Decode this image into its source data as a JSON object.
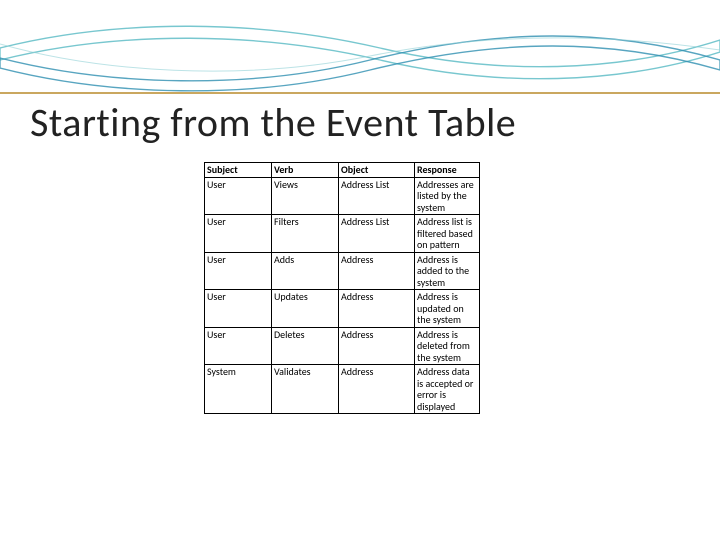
{
  "title": "Starting from the Event Table",
  "table": {
    "headers": {
      "subject": "Subject",
      "verb": "Verb",
      "object": "Object",
      "response": "Response"
    },
    "rows": [
      {
        "subject": "User",
        "verb": "Views",
        "object": "Address List",
        "response": "Addresses are listed by the system"
      },
      {
        "subject": "User",
        "verb": "Filters",
        "object": "Address List",
        "response": "Address list is filtered based on pattern"
      },
      {
        "subject": "User",
        "verb": "Adds",
        "object": "Address",
        "response": "Address is added to the system"
      },
      {
        "subject": "User",
        "verb": "Updates",
        "object": "Address",
        "response": "Address is updated on the system"
      },
      {
        "subject": "User",
        "verb": "Deletes",
        "object": "Address",
        "response": "Address is deleted from the system"
      },
      {
        "subject": "System",
        "verb": "Validates",
        "object": "Address",
        "response": "Address data is accepted or error is displayed"
      }
    ]
  }
}
